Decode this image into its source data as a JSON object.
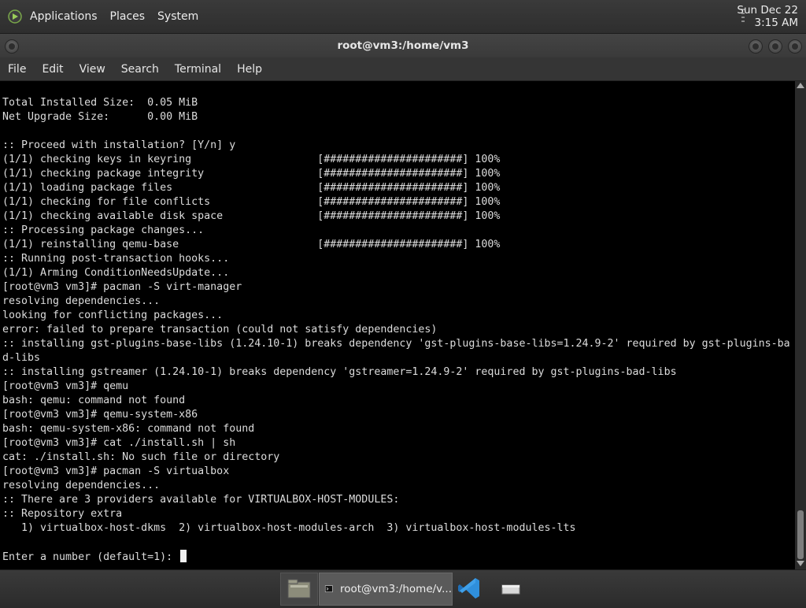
{
  "top_panel": {
    "menu": [
      "Applications",
      "Places",
      "System"
    ],
    "clock_date": "Sun Dec 22",
    "clock_time": "3:15 AM"
  },
  "window": {
    "title": "root@vm3:/home/vm3"
  },
  "menubar": [
    "File",
    "Edit",
    "View",
    "Search",
    "Terminal",
    "Help"
  ],
  "terminal": {
    "lines": [
      "Total Installed Size:  0.05 MiB",
      "Net Upgrade Size:      0.00 MiB",
      "",
      ":: Proceed with installation? [Y/n] y",
      "(1/1) checking keys in keyring                    [######################] 100%",
      "(1/1) checking package integrity                  [######################] 100%",
      "(1/1) loading package files                       [######################] 100%",
      "(1/1) checking for file conflicts                 [######################] 100%",
      "(1/1) checking available disk space               [######################] 100%",
      ":: Processing package changes...",
      "(1/1) reinstalling qemu-base                      [######################] 100%",
      ":: Running post-transaction hooks...",
      "(1/1) Arming ConditionNeedsUpdate...",
      "[root@vm3 vm3]# pacman -S virt-manager",
      "resolving dependencies...",
      "looking for conflicting packages...",
      "error: failed to prepare transaction (could not satisfy dependencies)",
      ":: installing gst-plugins-base-libs (1.24.10-1) breaks dependency 'gst-plugins-base-libs=1.24.9-2' required by gst-plugins-ba",
      "d-libs",
      ":: installing gstreamer (1.24.10-1) breaks dependency 'gstreamer=1.24.9-2' required by gst-plugins-bad-libs",
      "[root@vm3 vm3]# qemu",
      "bash: qemu: command not found",
      "[root@vm3 vm3]# qemu-system-x86",
      "bash: qemu-system-x86: command not found",
      "[root@vm3 vm3]# cat ./install.sh | sh",
      "cat: ./install.sh: No such file or directory",
      "[root@vm3 vm3]# pacman -S virtualbox",
      "resolving dependencies...",
      ":: There are 3 providers available for VIRTUALBOX-HOST-MODULES:",
      ":: Repository extra",
      "   1) virtualbox-host-dkms  2) virtualbox-host-modules-arch  3) virtualbox-host-modules-lts",
      "",
      "Enter a number (default=1): "
    ]
  },
  "taskbar": {
    "terminal_task_label": "root@vm3:/home/v...",
    "vscode_color": "#2f8fdc"
  },
  "icons": {
    "applications": "apps-icon",
    "files": "file-manager-icon",
    "terminal": "terminal-icon",
    "vscode": "vscode-icon",
    "show_desktop": "show-desktop-icon"
  }
}
